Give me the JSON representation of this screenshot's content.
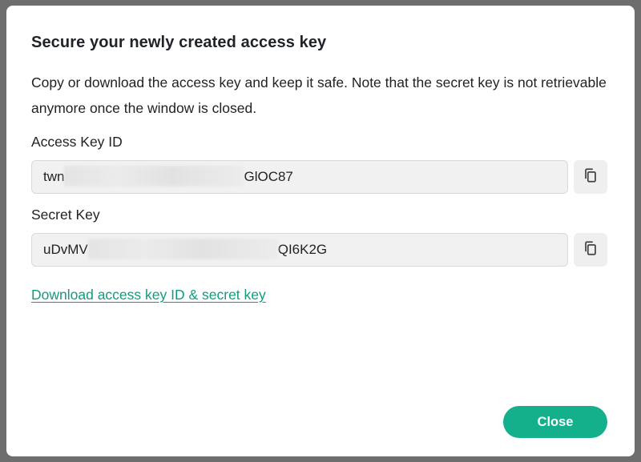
{
  "dialog": {
    "title": "Secure your newly created access key",
    "description": "Copy or download the access key and keep it safe. Note that the secret key is not retrievable anymore once the window is closed.",
    "access_key": {
      "label": "Access Key ID",
      "prefix": "twn",
      "suffix": "GlOC87",
      "copy_icon": "copy-icon"
    },
    "secret_key": {
      "label": "Secret Key",
      "prefix": "uDvMV",
      "suffix": "QI6K2G",
      "copy_icon": "copy-icon"
    },
    "download_link": "Download access key ID & secret key",
    "close_label": "Close"
  },
  "colors": {
    "accent": "#14b08b",
    "link": "#0f9d7e",
    "overlay": "#6e6e6e"
  }
}
